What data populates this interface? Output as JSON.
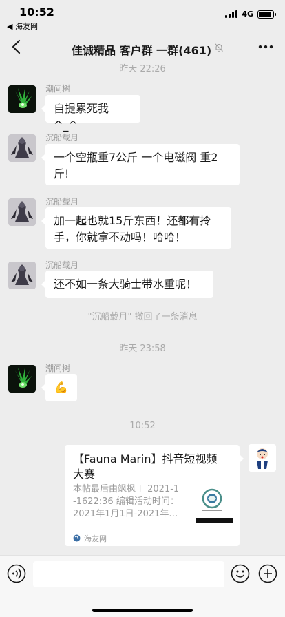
{
  "status_bar": {
    "time": "10:52",
    "back_app": "◀ 海友网",
    "network": "4G",
    "battery_level": 0.9
  },
  "header": {
    "title": "佳诚精品 客户群 一群(461)",
    "back_icon": "chevron-left-icon",
    "mute_icon": "bell-off-icon",
    "more_icon": "more-icon"
  },
  "messages": {
    "t1": "昨天 22:26",
    "m1": {
      "sender": "潮间树",
      "text": "自提累死我^_^"
    },
    "m2": {
      "sender": "沉船载月",
      "line1": "一个空瓶重7公斤 一个电磁阀 重2",
      "line2": "斤!"
    },
    "m3": {
      "sender": "沉船载月",
      "line1": "加一起也就15斤东西！还都有拎",
      "line2": "手，你就拿不动吗！哈哈！"
    },
    "m4": {
      "sender": "沉船载月",
      "text": "还不如一条大骑士带水重呢！"
    },
    "recall": "\"沉船载月\" 撤回了一条消息",
    "t2": "昨天 23:58",
    "m5": {
      "sender": "潮间树",
      "text": "💪"
    },
    "t3": "10:52",
    "card": {
      "title_line1": "【Fauna Marin】抖音短视频",
      "title_line2": "大赛",
      "desc_line1": "本帖最后由飒枫于 2021-1",
      "desc_line2": "-1622:36 编辑活动时间：",
      "desc_line3": "2021年1月1日-2021年…",
      "source": "海友网"
    }
  },
  "input_bar": {
    "placeholder": "",
    "voice_icon": "voice-icon",
    "emoji_icon": "emoji-icon",
    "plus_icon": "plus-icon"
  }
}
